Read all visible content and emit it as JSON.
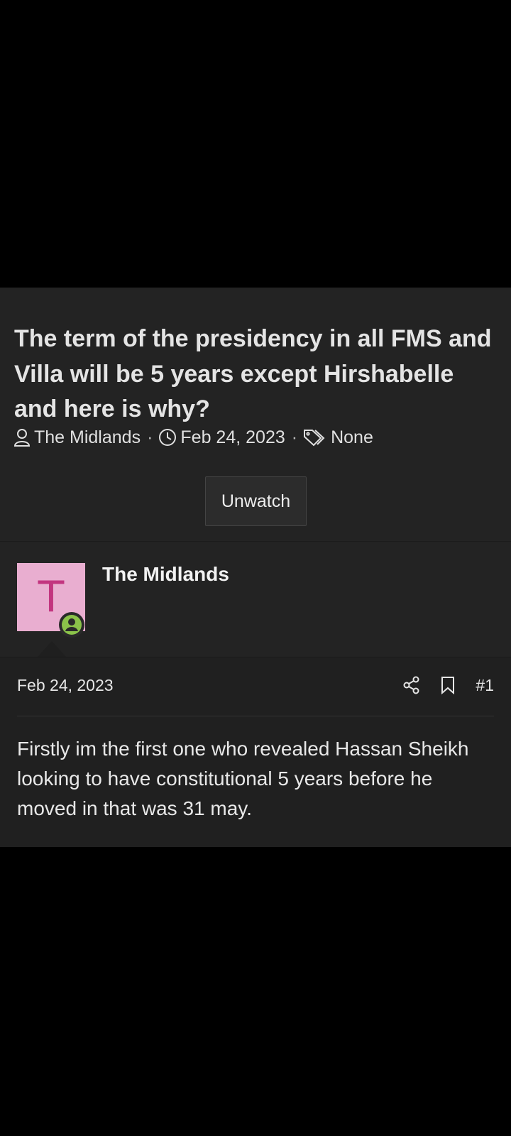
{
  "thread": {
    "title": "The term of the presidency in all FMS and Villa will be 5 years except Hirshabelle and here is why?",
    "meta": {
      "author": "The Midlands",
      "date": "Feb 24, 2023",
      "tags": "None",
      "separator": "·"
    },
    "unwatch_label": "Unwatch"
  },
  "post": {
    "author_name": "The Midlands",
    "avatar_letter": "T",
    "date": "Feb 24, 2023",
    "number": "#1",
    "body": "Firstly im the first one who revealed Hassan Sheikh looking to have constitutional 5 years before he moved in that was 31 may."
  },
  "colors": {
    "panel_bg": "#232323",
    "avatar_bg": "#e9aed0",
    "avatar_letter": "#c2357f",
    "online_badge": "#8bc34a"
  },
  "icons": {
    "author": "user-icon",
    "date": "clock-icon",
    "tags": "tags-icon",
    "share": "share-icon",
    "bookmark": "bookmark-icon",
    "online": "online-user-icon"
  }
}
